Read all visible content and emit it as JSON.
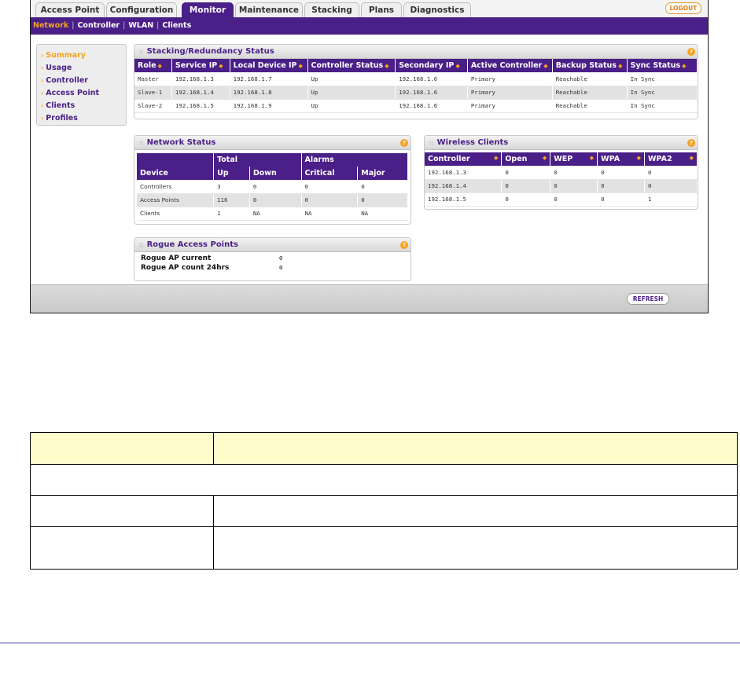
{
  "tabs": [
    {
      "label": "Access Point",
      "active": false
    },
    {
      "label": "Configuration",
      "active": false
    },
    {
      "label": "Monitor",
      "active": true
    },
    {
      "label": "Maintenance",
      "active": false
    },
    {
      "label": "Stacking",
      "active": false
    },
    {
      "label": "Plans",
      "active": false
    },
    {
      "label": "Diagnostics",
      "active": false
    }
  ],
  "logout_label": "LOGOUT",
  "subnav": [
    {
      "label": "Network",
      "active": true
    },
    {
      "label": "Controller",
      "active": false
    },
    {
      "label": "WLAN",
      "active": false
    },
    {
      "label": "Clients",
      "active": false
    }
  ],
  "sidebar": [
    {
      "label": "Summary",
      "active": true
    },
    {
      "label": "Usage",
      "active": false
    },
    {
      "label": "Controller",
      "active": false
    },
    {
      "label": "Access Point",
      "active": false
    },
    {
      "label": "Clients",
      "active": false
    },
    {
      "label": "Profiles",
      "active": false
    }
  ],
  "stacking": {
    "title": "Stacking/Redundancy Status",
    "columns": [
      "Role",
      "Service IP",
      "Local Device IP",
      "Controller Status",
      "Secondary IP",
      "Active Controller",
      "Backup Status",
      "Sync Status"
    ],
    "rows": [
      [
        "Master",
        "192.168.1.3",
        "192.168.1.7",
        "Up",
        "192.168.1.6",
        "Primary",
        "Reachable",
        "In Sync"
      ],
      [
        "Slave-1",
        "192.168.1.4",
        "192.168.1.8",
        "Up",
        "192.168.1.6",
        "Primary",
        "Reachable",
        "In Sync"
      ],
      [
        "Slave-2",
        "192.168.1.5",
        "192.168.1.9",
        "Up",
        "192.168.1.6",
        "Primary",
        "Reachable",
        "In Sync"
      ]
    ]
  },
  "network_status": {
    "title": "Network Status",
    "group_headers": [
      "Total",
      "Alarms"
    ],
    "columns": [
      "Device",
      "Up",
      "Down",
      "Critical",
      "Major"
    ],
    "rows": [
      [
        "Controllers",
        "3",
        "0",
        "0",
        "0"
      ],
      [
        "Access Points",
        "116",
        "0",
        "0",
        "0"
      ],
      [
        "Clients",
        "1",
        "NA",
        "NA",
        "NA"
      ]
    ]
  },
  "wireless_clients": {
    "title": "Wireless Clients",
    "columns": [
      "Controller",
      "Open",
      "WEP",
      "WPA",
      "WPA2"
    ],
    "rows": [
      [
        "192.168.1.3",
        "0",
        "0",
        "0",
        "0"
      ],
      [
        "192.168.1.4",
        "0",
        "0",
        "0",
        "0"
      ],
      [
        "192.168.1.5",
        "0",
        "0",
        "0",
        "1"
      ]
    ]
  },
  "rogue": {
    "title": "Rogue Access Points",
    "rows": [
      {
        "label": "Rogue AP current",
        "value": "0"
      },
      {
        "label": "Rogue AP count 24hrs",
        "value": "0"
      }
    ]
  },
  "refresh_label": "REFRESH",
  "colors": {
    "brand_purple": "#4a1f87",
    "accent_orange": "#f4a31f",
    "doc_header_bg": "#fffccc"
  },
  "icons": {
    "help": "help-icon",
    "sort": "sort-icon",
    "chevron": "chevron-right-icon"
  }
}
